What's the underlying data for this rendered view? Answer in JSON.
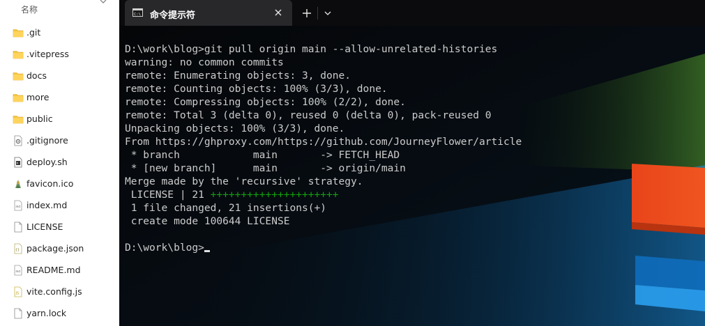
{
  "explorer": {
    "column_header": "名称",
    "files": [
      {
        "name": ".git",
        "icon": "folder-icon"
      },
      {
        "name": ".vitepress",
        "icon": "folder-icon"
      },
      {
        "name": "docs",
        "icon": "folder-icon"
      },
      {
        "name": "more",
        "icon": "folder-icon"
      },
      {
        "name": "public",
        "icon": "folder-icon"
      },
      {
        "name": ".gitignore",
        "icon": "settings-file-icon"
      },
      {
        "name": "deploy.sh",
        "icon": "script-file-icon"
      },
      {
        "name": "favicon.ico",
        "icon": "image-file-icon"
      },
      {
        "name": "index.md",
        "icon": "markdown-file-icon"
      },
      {
        "name": "LICENSE",
        "icon": "blank-file-icon"
      },
      {
        "name": "package.json",
        "icon": "json-file-icon"
      },
      {
        "name": "README.md",
        "icon": "markdown-file-icon"
      },
      {
        "name": "vite.config.js",
        "icon": "js-file-icon"
      },
      {
        "name": "yarn.lock",
        "icon": "blank-file-icon"
      }
    ]
  },
  "terminal": {
    "tab_title": "命令提示符",
    "lines": [
      "D:\\work\\blog>git pull origin main --allow-unrelated-histories",
      "warning: no common commits",
      "remote: Enumerating objects: 3, done.",
      "remote: Counting objects: 100% (3/3), done.",
      "remote: Compressing objects: 100% (2/2), done.",
      "remote: Total 3 (delta 0), reused 0 (delta 0), pack-reused 0",
      "Unpacking objects: 100% (3/3), done.",
      "From https://ghproxy.com/https://github.com/JourneyFlower/article",
      " * branch            main       -> FETCH_HEAD",
      " * [new branch]      main       -> origin/main",
      "Merge made by the 'recursive' strategy.",
      " LICENSE | 21 ",
      " 1 file changed, 21 insertions(+)",
      " create mode 100644 LICENSE",
      ""
    ],
    "diffstat_plus": "+++++++++++++++++++++",
    "prompt": "D:\\work\\blog>"
  },
  "colors": {
    "console_text": "#cccccc",
    "diff_plus": "#13a10e",
    "tab_bg": "#28282b",
    "folder": "#f5c542"
  }
}
